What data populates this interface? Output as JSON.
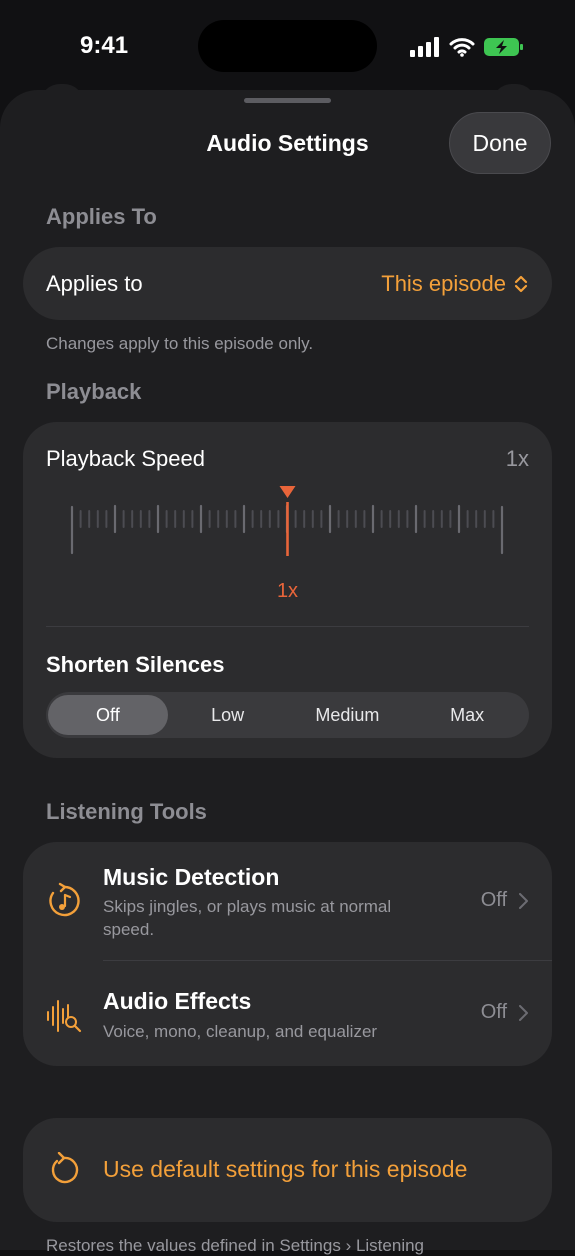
{
  "status_bar": {
    "time": "9:41"
  },
  "header": {
    "title": "Audio Settings",
    "done_label": "Done"
  },
  "applies_section": {
    "heading": "Applies To",
    "row_label": "Applies to",
    "selected_value": "This episode",
    "footnote": "Changes apply to this episode only."
  },
  "playback_section": {
    "heading": "Playback",
    "speed_label": "Playback Speed",
    "speed_value": "1x",
    "speed_readout": "1x",
    "shorten_silences_label": "Shorten Silences",
    "shorten_silences_options": [
      "Off",
      "Low",
      "Medium",
      "Max"
    ],
    "shorten_silences_selected": "Off"
  },
  "listening_tools_section": {
    "heading": "Listening Tools",
    "items": [
      {
        "title": "Music Detection",
        "description": "Skips jingles, or plays music at normal speed.",
        "state": "Off",
        "icon": "music-detection-icon"
      },
      {
        "title": "Audio Effects",
        "description": "Voice, mono, cleanup, and equalizer",
        "state": "Off",
        "icon": "audio-effects-icon"
      }
    ]
  },
  "defaults": {
    "button_label": "Use default settings for this episode",
    "footnote": "Restores the values defined in Settings › Listening"
  },
  "colors": {
    "accent": "#f3a03a",
    "speed_marker": "#e9653a",
    "battery": "#3ec552"
  }
}
